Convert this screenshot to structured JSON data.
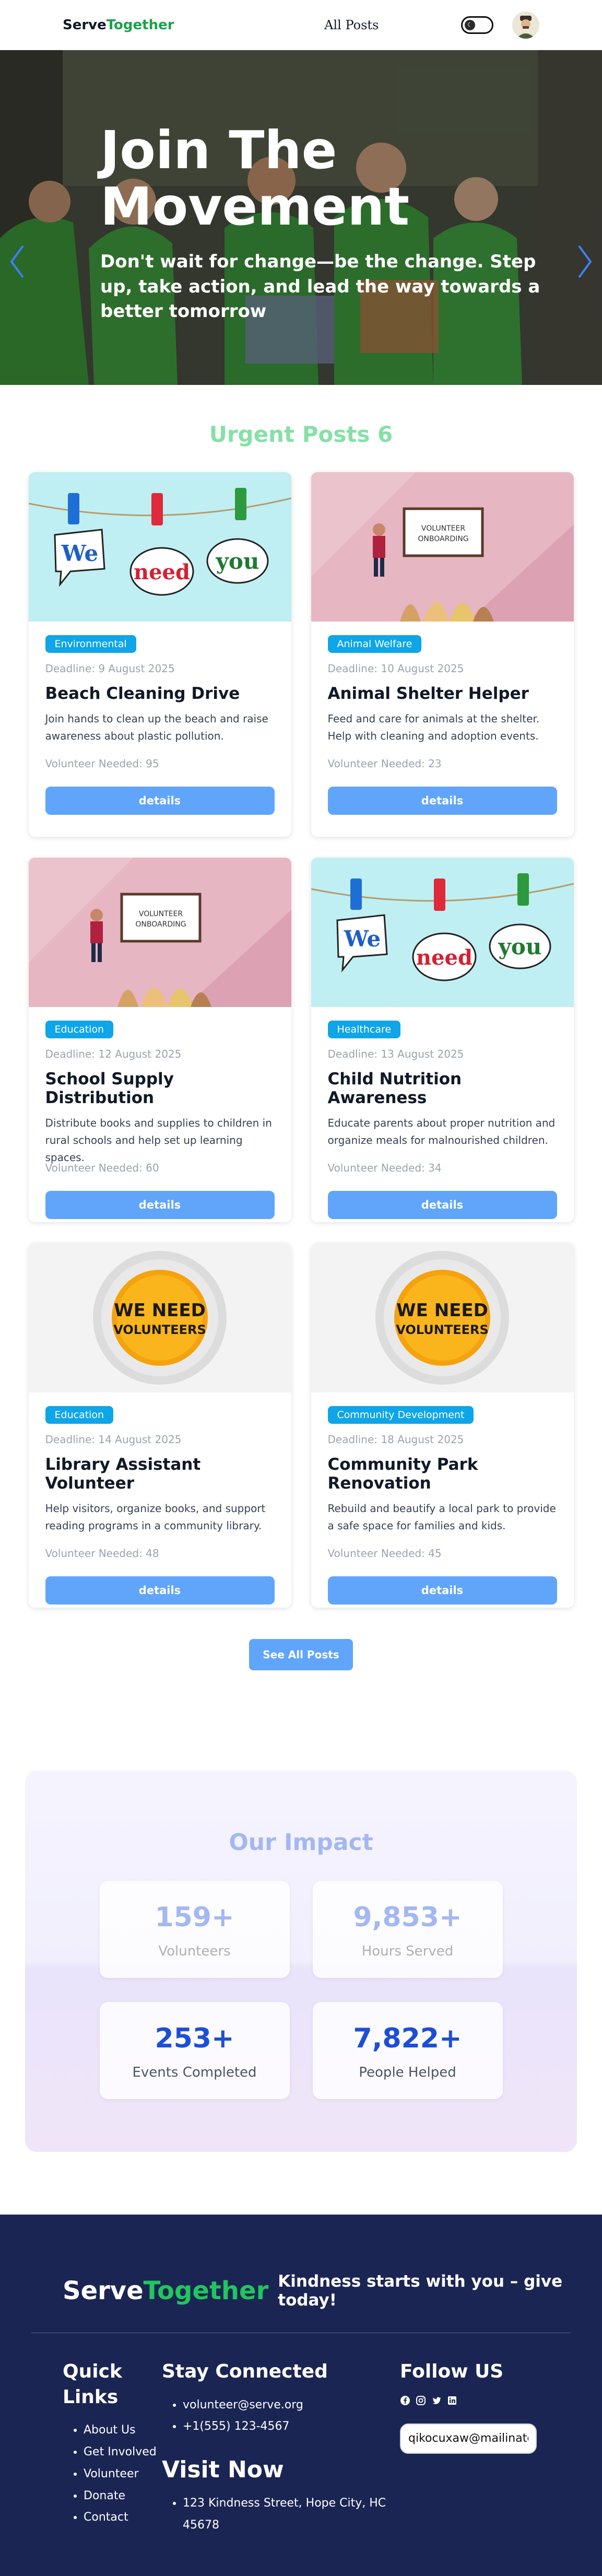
{
  "navbar": {
    "brand_part1": "Serve",
    "brand_part2": "Together",
    "all_posts": "All Posts",
    "toggle_icon": "moon-icon"
  },
  "hero": {
    "title": "Join The Movement",
    "subtitle": "Don't wait for change—be the change. Step up, take action, and lead the way towards a better tomorrow"
  },
  "urgent": {
    "title": "Urgent Posts 6",
    "posts": [
      {
        "category": "Environmental",
        "deadline": "Deadline: 9 August 2025",
        "title": "Beach Cleaning Drive",
        "description": "Join hands to clean up the beach and raise awareness about plastic pollution.",
        "volunteers": "Volunteer Needed: 95",
        "button": "details",
        "image": "we-need-you"
      },
      {
        "category": "Animal Welfare",
        "deadline": "Deadline: 10 August 2025",
        "title": "Animal Shelter Helper",
        "description": "Feed and care for animals at the shelter. Help with cleaning and adoption events.",
        "volunteers": "Volunteer Needed: 23",
        "button": "details",
        "image": "volunteer-onboarding"
      },
      {
        "category": "Education",
        "deadline": "Deadline: 12 August 2025",
        "title": "School Supply Distribution",
        "description": "Distribute books and supplies to children in rural schools and help set up learning spaces.",
        "volunteers": "Volunteer Needed: 60",
        "button": "details",
        "image": "volunteer-onboarding"
      },
      {
        "category": "Healthcare",
        "deadline": "Deadline: 13 August 2025",
        "title": "Child Nutrition Awareness",
        "description": "Educate parents about proper nutrition and organize meals for malnourished children.",
        "volunteers": "Volunteer Needed: 34",
        "button": "details",
        "image": "we-need-you"
      },
      {
        "category": "Education",
        "deadline": "Deadline: 14 August 2025",
        "title": "Library Assistant Volunteer",
        "description": "Help visitors, organize books, and support reading programs in a community library.",
        "volunteers": "Volunteer Needed: 48",
        "button": "details",
        "image": "we-need-volunteers"
      },
      {
        "category": "Community Development",
        "deadline": "Deadline: 18 August 2025",
        "title": "Community Park Renovation",
        "description": "Rebuild and beautify a local park to provide a safe space for families and kids.",
        "volunteers": "Volunteer Needed: 45",
        "button": "details",
        "image": "we-need-volunteers"
      }
    ],
    "see_all": "See All Posts"
  },
  "impact": {
    "title": "Our Impact",
    "stats": [
      {
        "value": "159+",
        "label": "Volunteers"
      },
      {
        "value": "9,853+",
        "label": "Hours Served"
      },
      {
        "value": "253+",
        "label": "Events Completed"
      },
      {
        "value": "7,822+",
        "label": "People Helped"
      }
    ]
  },
  "image_text": {
    "we": "We",
    "need": "need",
    "you": "you",
    "onboarding_line1": "VOLUNTEER",
    "onboarding_line2": "ONBOARDING",
    "wnv_line1": "WE NEED",
    "wnv_line2": "VOLUNTEERS"
  },
  "footer": {
    "brand_part1": "Serve",
    "brand_part2": "Together",
    "tagline": "Kindness starts with you – give today!",
    "quick_links_title": "Quick Links",
    "quick_links": [
      "About Us",
      "Get Involved",
      "Volunteer",
      "Donate",
      "Contact"
    ],
    "stay_title": "Stay Connected",
    "email": "volunteer@serve.org",
    "phone": "+1(555) 123-4567",
    "visit_title": "Visit Now",
    "address": "123 Kindness Street, Hope City, HC 45678",
    "follow_title": "Follow US",
    "social_icons": [
      "facebook-icon",
      "instagram-icon",
      "twitter-icon",
      "linkedin-icon"
    ],
    "email_input_value": "qikocuxaw@mailinatc"
  },
  "colors": {
    "brand_green": "#16a34a",
    "badge_blue": "#0ea5e9",
    "button_blue": "#60a5fa",
    "footer_bg": "#1b2553"
  }
}
